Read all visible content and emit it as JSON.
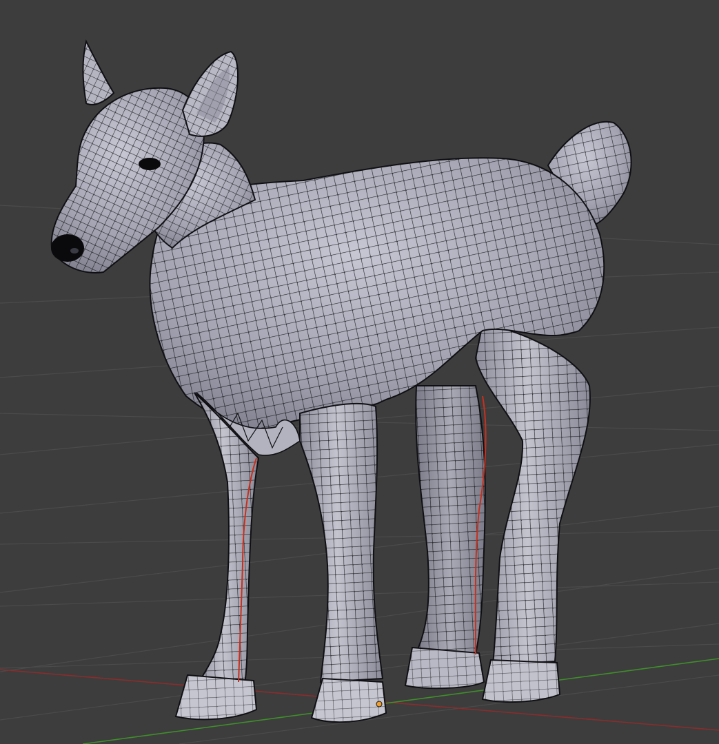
{
  "viewport": {
    "background": "#3d3d3d",
    "grid_color": "#4b4b4b",
    "axis_x_color": "#8b2c2c",
    "axis_y_color": "#3f8f2a"
  },
  "mesh": {
    "subject": "fawn",
    "surface_color": "#a9a9b6",
    "wire_color": "#0f0f12",
    "seam_color": "#c8301e",
    "selected_vertex_color": "#f0a030"
  }
}
